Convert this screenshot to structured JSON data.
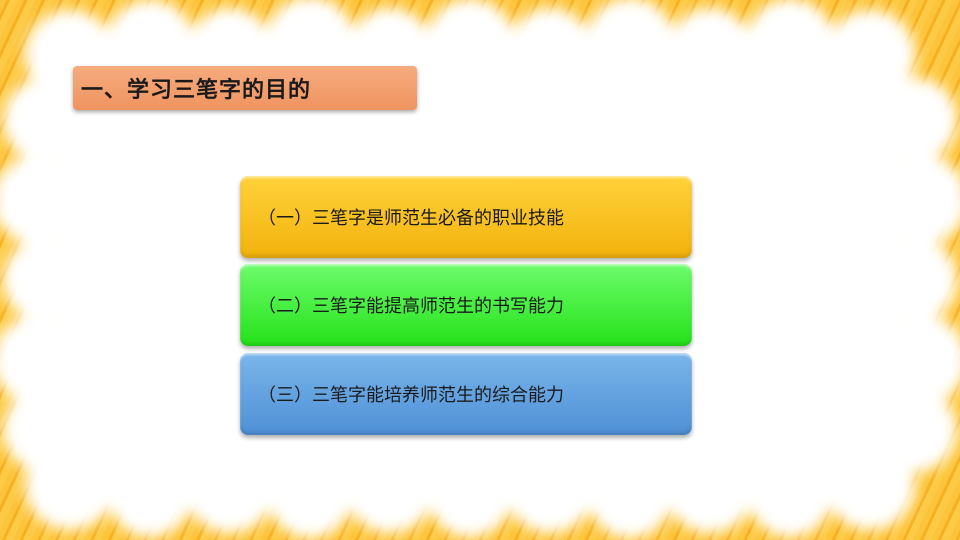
{
  "slide": {
    "title": "一、学习三笔字的目的",
    "items": [
      {
        "label": "（一）三笔字是师范生必备的职业技能",
        "color": "#f5bb12"
      },
      {
        "label": "（二）三笔字能提高师范生的书写能力",
        "color": "#34e82a"
      },
      {
        "label": "（三）三笔字能培养师范生的综合能力",
        "color": "#5f9fdf"
      }
    ]
  },
  "colors": {
    "background": "#fbbf2c",
    "title_bar": "#f29a66",
    "panel": "#ffffff"
  }
}
